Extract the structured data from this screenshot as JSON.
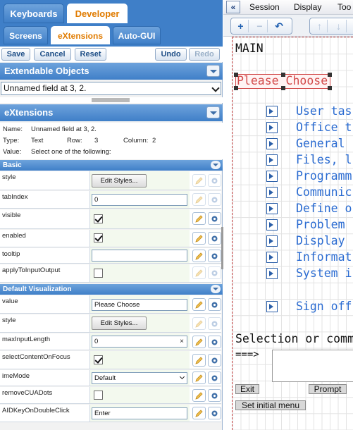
{
  "main_tabs": [
    {
      "label": "Keyboards",
      "active": false
    },
    {
      "label": "Developer",
      "active": true
    }
  ],
  "sub_tabs": [
    {
      "label": "Screens",
      "active": false
    },
    {
      "label": "eXtensions",
      "active": true
    },
    {
      "label": "Auto-GUI",
      "active": false
    }
  ],
  "toolbar": {
    "save": "Save",
    "cancel": "Cancel",
    "reset": "Reset",
    "undo": "Undo",
    "redo": "Redo"
  },
  "extendable_objects": {
    "title": "Extendable Objects",
    "selected": "Unnamed field at 3, 2."
  },
  "extensions": {
    "title": "eXtensions",
    "info": {
      "name_label": "Name:",
      "name_value": "Unnamed field at 3, 2.",
      "type_label": "Type:",
      "type_value": "Text",
      "row_label": "Row:",
      "row_value": "3",
      "column_label": "Column:",
      "column_value": "2",
      "value_label": "Value:",
      "value_value": "Select one of the following:"
    }
  },
  "basic": {
    "title": "Basic",
    "rows": [
      {
        "label": "style",
        "button": "Edit Styles..."
      },
      {
        "label": "tabIndex",
        "value": "0"
      },
      {
        "label": "visible",
        "checked": true
      },
      {
        "label": "enabled",
        "checked": true
      },
      {
        "label": "tooltip",
        "value": ""
      },
      {
        "label": "applyToInputOutput",
        "checked": false
      }
    ]
  },
  "default_visualization": {
    "title": "Default Visualization",
    "rows": [
      {
        "label": "value",
        "value": "Please Choose"
      },
      {
        "label": "style",
        "button": "Edit Styles..."
      },
      {
        "label": "maxInputLength",
        "value": "0",
        "clear": "×"
      },
      {
        "label": "selectContentOnFocus",
        "checked": true
      },
      {
        "label": "imeMode",
        "value": "Default"
      },
      {
        "label": "removeCUADots",
        "checked": false
      },
      {
        "label": "AIDKeyOnDoubleClick",
        "value": "Enter"
      }
    ]
  },
  "session_menu": {
    "collapse": "«",
    "items": [
      "Session",
      "Display",
      "Too"
    ]
  },
  "session_toolbar": {
    "icons": [
      "add-icon",
      "remove-icon",
      "undo-icon",
      "move-up-icon",
      "move-down-icon"
    ]
  },
  "screen": {
    "title": "MAIN",
    "selected_field": "Please Choose",
    "menu_items": [
      "User tas",
      "Office t",
      "General",
      "Files, l",
      "Programm",
      "Communic",
      "Define o",
      "Problem",
      "Display",
      "Informat",
      "System i"
    ],
    "signoff": "Sign off",
    "selection_prompt": "Selection or comm",
    "arrow": "===>",
    "exit_button": "Exit",
    "prompt_button": "Prompt",
    "initial_menu_button": "Set initial menu"
  }
}
